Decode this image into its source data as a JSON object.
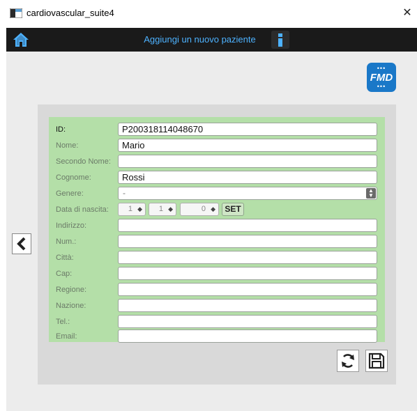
{
  "window": {
    "title": "cardiovascular_suite4",
    "close_glyph": "✕"
  },
  "header": {
    "title": "Aggiungi un nuovo paziente",
    "home_icon": "home-icon",
    "info_icon": "info-icon"
  },
  "logo": {
    "text": "FMD",
    "dots": "•••"
  },
  "form": {
    "id": {
      "label": "ID:",
      "value": "P200318114048670"
    },
    "nome": {
      "label": "Nome:",
      "value": "Mario"
    },
    "secondo_nome": {
      "label": "Secondo Nome:",
      "value": ""
    },
    "cognome": {
      "label": "Cognome:",
      "value": "Rossi"
    },
    "genere": {
      "label": "Genere:",
      "value": "-"
    },
    "data_nascita": {
      "label": "Data di nascita:",
      "day": "1",
      "month": "1",
      "year": "0",
      "set_label": "SET"
    },
    "indirizzo": {
      "label": "Indirizzo:",
      "value": ""
    },
    "num": {
      "label": "Num.:",
      "value": ""
    },
    "citta": {
      "label": "Città:",
      "value": ""
    },
    "cap": {
      "label": "Cap:",
      "value": ""
    },
    "regione": {
      "label": "Regione:",
      "value": ""
    },
    "nazione": {
      "label": "Nazione:",
      "value": ""
    },
    "tel": {
      "label": "Tel.:",
      "value": ""
    },
    "email": {
      "label": "Email:",
      "value": ""
    }
  },
  "colors": {
    "accent": "#4db2ff",
    "form_bg": "#b4dfa8",
    "logo_bg": "#1a78c8"
  }
}
